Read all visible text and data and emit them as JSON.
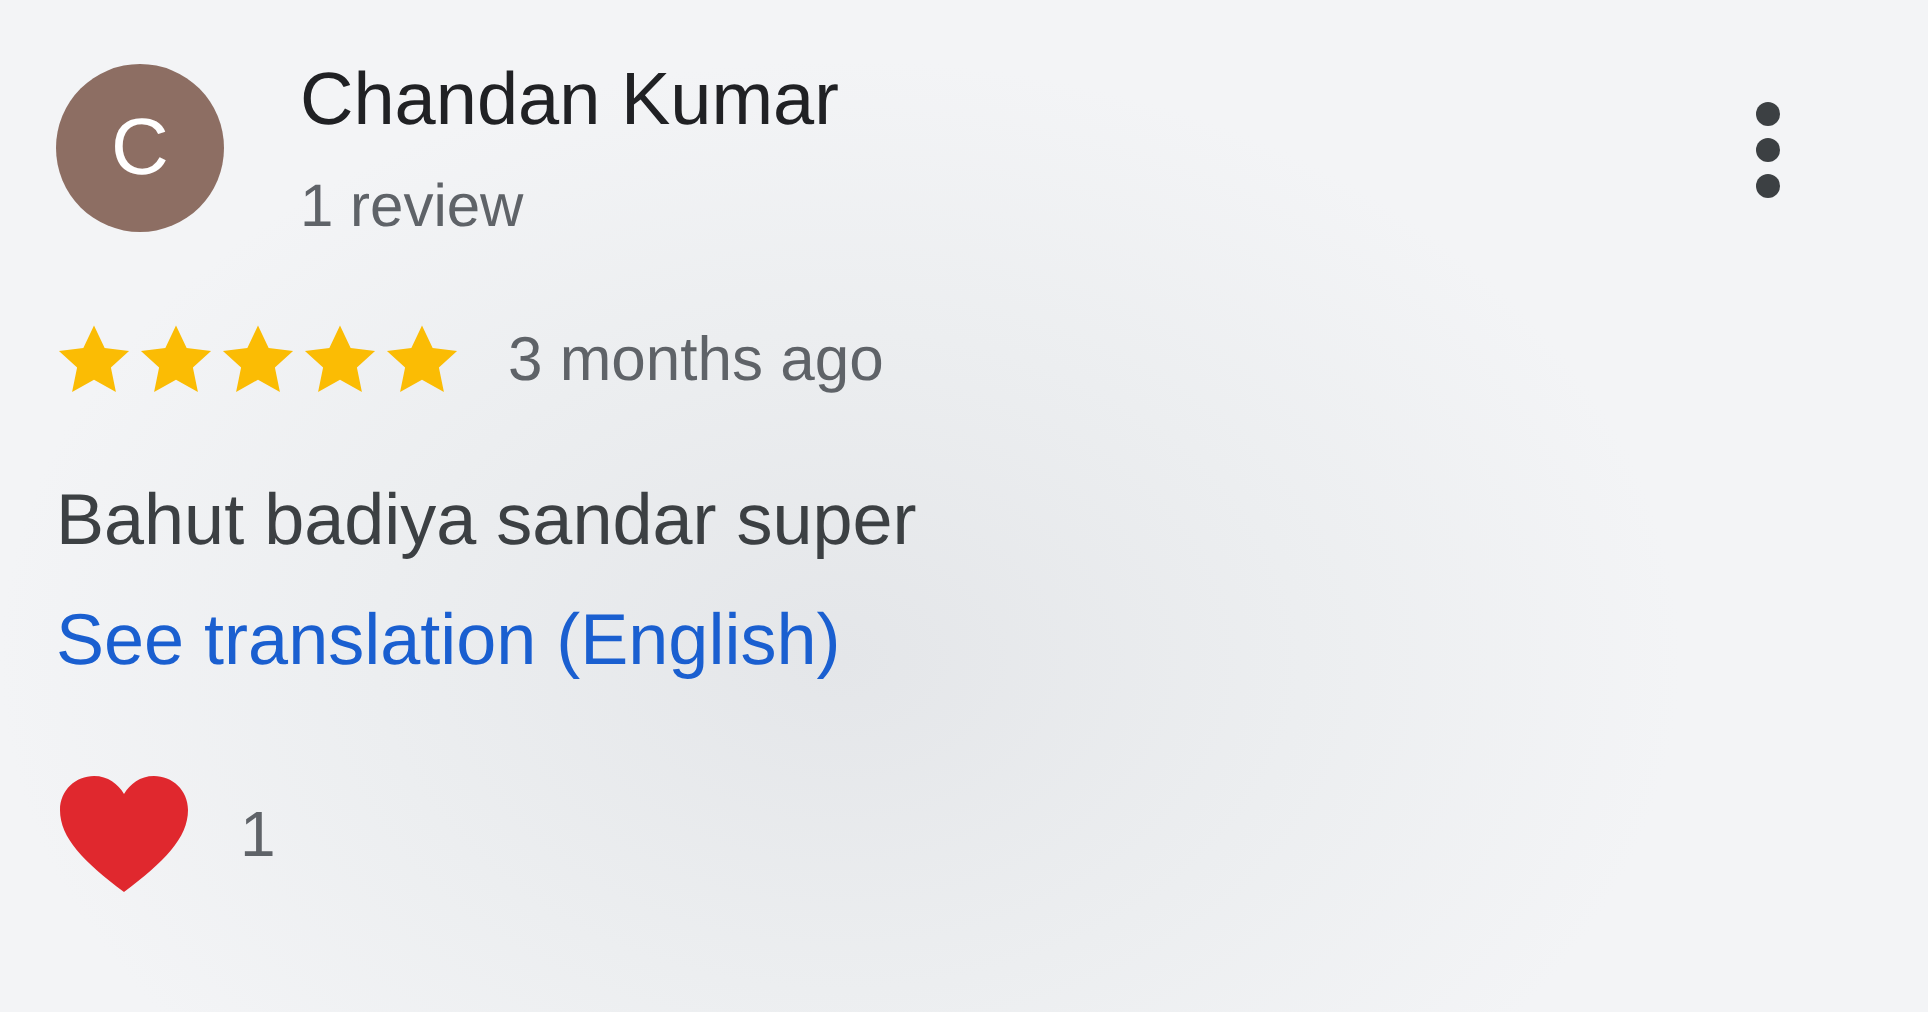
{
  "review": {
    "avatar_letter": "C",
    "author": "Chandan Kumar",
    "review_count": "1 review",
    "stars": 5,
    "time": "3 months ago",
    "text": "Bahut badiya sandar super",
    "translation_link": "See translation (English)",
    "reactions": {
      "count": "1"
    }
  }
}
